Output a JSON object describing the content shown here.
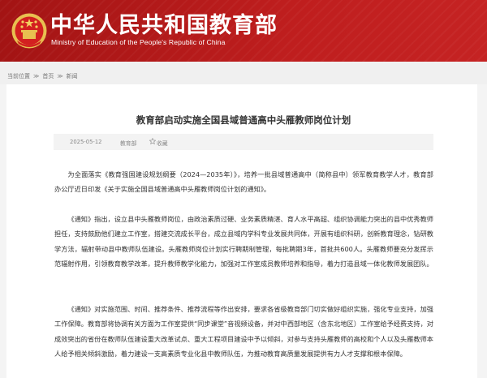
{
  "header": {
    "title": "中华人民共和国教育部",
    "subtitle": "Ministry of Education of the People's Republic of China",
    "emblem_icon": "national-emblem-icon",
    "colors": {
      "header_bg": "#b01818",
      "emblem_gold": "#e8c050",
      "emblem_red": "#d32020"
    }
  },
  "breadcrumb": {
    "items": [
      "当前位置",
      "首页",
      "新闻"
    ],
    "separator": "≫"
  },
  "article": {
    "title": "教育部启动实施全国县域普通高中头雁教师岗位计划",
    "date": "2025-05-12",
    "source": "教育部",
    "favorite_icon": "star-icon",
    "favorite_label": "收藏",
    "paragraphs": [
      "为全面落实《教育强国建设规划纲要（2024—2035年）》，培养一批县域普通高中（简称县中）领军教育教学人才，教育部办公厅近日印发《关于实施全国县域普通高中头雁教师岗位计划的通知》。",
      "《通知》指出，设立县中头雁教师岗位，由政治素质过硬、业务素质精湛、育人水平高超、组织协调能力突出的县中优秀教师担任，支持鼓励他们建立工作室，搭建交流成长平台，成立县域内学科专业发展共同体，开展有组织科研，创新教育理念，钻研教学方法，辐射带动县中教师队伍建设。头雁教师岗位计划实行聘期制管理，每批聘期3年，首批共600人。头雁教师要充分发挥示范辐射作用，引领教育教学改革，提升教师教学化能力，加强对工作室成员教师培养和指导，着力打造县域一体化教师发展团队。",
      "《通知》对实施范围、时间、推荐条件、推荐流程等作出安排，要求各省级教育部门切实做好组织实施，强化专业支持，加强工作保障。教育部将协调有关方面为工作室提供“同步课堂”音视频设备，并对中西部地区（含东北地区）工作室给予经费支持，对成效突出的省份在教师队伍建设重大改革试点、重大工程项目建设中予以倾斜，对参与支持头雁教师的高校和个人以及头雁教师本人给予相关倾斜激励，着力建设一支高素质专业化县中教师队伍，为推动教育高质量发展提供有力人才支撑和根本保障。"
    ]
  }
}
